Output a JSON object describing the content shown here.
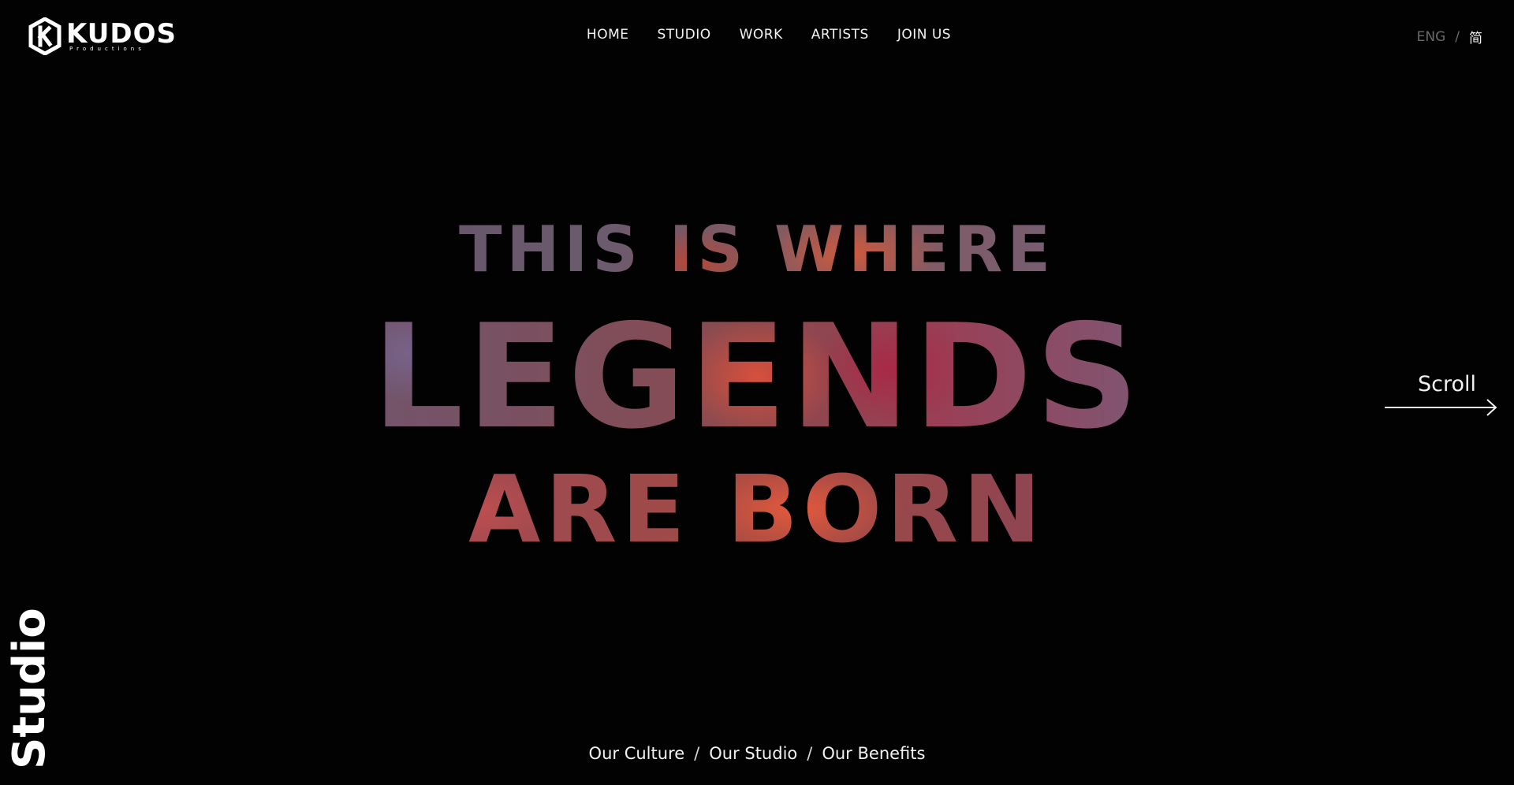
{
  "brand": {
    "name": "KUDOS",
    "subtitle": "Productions",
    "logo_icon": "kudos-hexagon-k"
  },
  "nav": {
    "items": [
      {
        "label": "HOME"
      },
      {
        "label": "STUDIO"
      },
      {
        "label": "WORK"
      },
      {
        "label": "ARTISTS"
      },
      {
        "label": "JOIN US"
      }
    ]
  },
  "lang": {
    "current": "ENG",
    "separator": "/",
    "alternate": "简"
  },
  "hero": {
    "line1": "THIS IS WHERE",
    "line2": "LEGENDS",
    "line3": "ARE BORN"
  },
  "scroll": {
    "label": "Scroll",
    "icon": "arrow-right-icon"
  },
  "section": {
    "vertical_label": "Studio"
  },
  "subnav": {
    "items": [
      {
        "label": "Our Culture"
      },
      {
        "label": "Our Studio"
      },
      {
        "label": "Our Benefits"
      }
    ],
    "separator": "/"
  },
  "colors": {
    "background": "#030203",
    "text": "#f2f2f2",
    "muted": "#6a6a6a",
    "hero_accent": "#a04a45"
  }
}
